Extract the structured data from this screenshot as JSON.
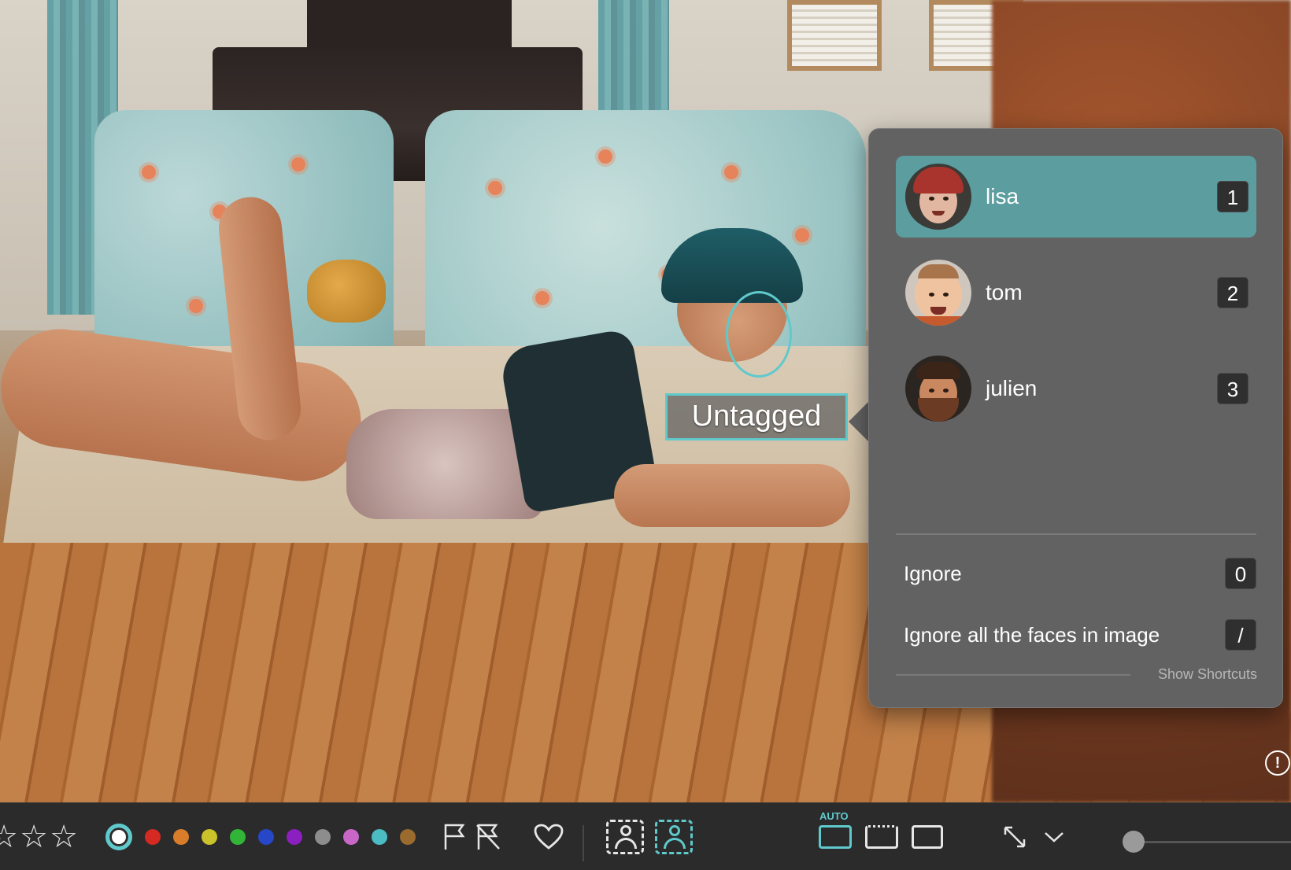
{
  "photo": {
    "face_label": "Untagged"
  },
  "popup": {
    "people": [
      {
        "name": "lisa",
        "shortcut": "1",
        "avatar": "avatar-lisa"
      },
      {
        "name": "tom",
        "shortcut": "2",
        "avatar": "avatar-tom"
      },
      {
        "name": "julien",
        "shortcut": "3",
        "avatar": "avatar-julien"
      }
    ],
    "selected_person": "lisa",
    "ignore": {
      "label": "Ignore",
      "shortcut": "0"
    },
    "ignore_all": {
      "label": "Ignore all the faces in image",
      "shortcut": "/"
    },
    "show_shortcuts": "Show Shortcuts"
  },
  "toolbar": {
    "rating_stars_visible": 3,
    "color_labels": [
      "#ffffff",
      "#d42a21",
      "#d97d2b",
      "#c9c22a",
      "#31b437",
      "#2747c9",
      "#8b1fbf",
      "#8d8d8d",
      "#c867c7",
      "#4bbcc4",
      "#9a6a2e"
    ],
    "selected_color": "#ffffff",
    "auto_label": "AUTO",
    "accent_color": "#5fc9cc",
    "icons": [
      "flag-icon",
      "unflag-icon",
      "heart-icon",
      "face-group-icon",
      "face-detect-icon",
      "auto-layout-icon",
      "grid-layout-icon",
      "single-layout-icon",
      "fullscreen-icon",
      "chevron-down-icon"
    ],
    "info_icon_glyph": "!"
  }
}
